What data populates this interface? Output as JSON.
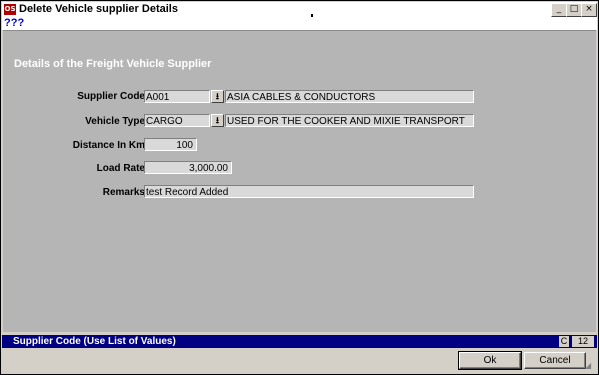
{
  "window": {
    "title": "Delete Vehicle supplier Details",
    "app_icon_text": "OS"
  },
  "menu": {
    "help": "???"
  },
  "form": {
    "heading": "Details of the Freight Vehicle Supplier",
    "supplier_code_label": "Supplier Code",
    "supplier_code_value": "A001",
    "supplier_name_value": "ASIA CABLES & CONDUCTORS",
    "vehicle_type_label": "Vehicle Type",
    "vehicle_type_value": "CARGO",
    "vehicle_type_desc": "USED FOR THE COOKER AND MIXIE TRANSPORT",
    "distance_label": "Distance In Km",
    "distance_value": "100",
    "load_rate_label": "Load Rate",
    "load_rate_value": "3,000.00",
    "remarks_label": "Remarks",
    "remarks_value": "test Record Added"
  },
  "status": {
    "hint": "Supplier Code (Use List of Values)",
    "mode": "C",
    "count": "12"
  },
  "buttons": {
    "ok": "Ok",
    "cancel": "Cancel"
  },
  "icons": {
    "lov": "down-arrow-icon",
    "minimize": "minimize-icon",
    "maximize": "maximize-icon",
    "close": "close-icon"
  }
}
